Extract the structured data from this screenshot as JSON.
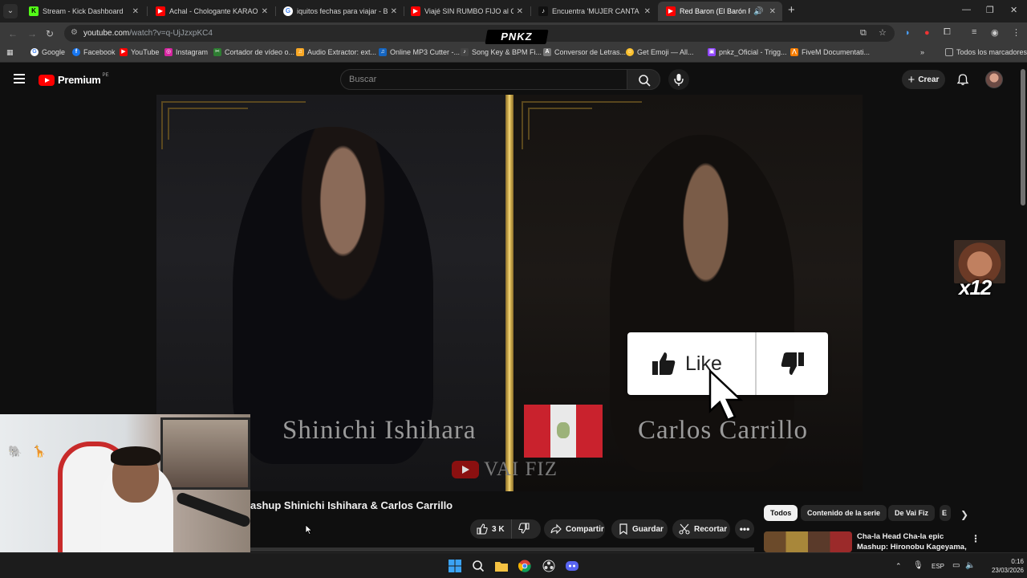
{
  "browser": {
    "tabs": [
      {
        "label": "Stream - Kick Dashboard",
        "icon": "kick-icon",
        "color": "#53fc18"
      },
      {
        "label": "Achal - Chologante KARAOKE (",
        "icon": "youtube-icon",
        "color": "#ff0000"
      },
      {
        "label": "iquitos fechas para viajar - Busc",
        "icon": "google-icon",
        "color": "#4285f4"
      },
      {
        "label": "Viajé SIN RUMBO FIJO al Coraz",
        "icon": "youtube-icon",
        "color": "#ff0000"
      },
      {
        "label": "Encuentra 'MUJER CANTA ORAC",
        "icon": "tiktok-icon",
        "color": "#ffffff"
      },
      {
        "label": "Red Baron (El Barón Rojo) c",
        "icon": "youtube-icon",
        "color": "#ff0000",
        "active": true
      }
    ],
    "url_host": "youtube.com",
    "url_path": "/watch?v=q-UjJzxpKC4",
    "overlay_logo": "PNKZ",
    "bookmarks": [
      {
        "label": "Google",
        "icon": "google-icon"
      },
      {
        "label": "Facebook",
        "icon": "facebook-icon"
      },
      {
        "label": "YouTube",
        "icon": "youtube-icon"
      },
      {
        "label": "Instagram",
        "icon": "instagram-icon"
      },
      {
        "label": "Cortador de vídeo o...",
        "icon": "scissors-icon"
      },
      {
        "label": "Audio Extractor: ext...",
        "icon": "audio-icon"
      },
      {
        "label": "Online MP3 Cutter -...",
        "icon": "audio-icon"
      },
      {
        "label": "Song Key & BPM Fi...",
        "icon": "music-icon"
      },
      {
        "label": "Conversor de Letras...",
        "icon": "text-icon"
      },
      {
        "label": "Get Emoji — All...",
        "icon": "emoji-icon"
      },
      {
        "label": "pnkz_Oficial - Trigg...",
        "icon": "twitch-icon"
      },
      {
        "label": "FiveM Documentati...",
        "icon": "fivem-icon"
      }
    ],
    "all_bookmarks": "Todos los marcadores"
  },
  "youtube": {
    "logo_word": "Premium",
    "region": "PE",
    "search_placeholder": "Buscar",
    "create_label": "Crear",
    "video": {
      "left_name": "Shinichi Ishihara",
      "right_name": "Carlos Carrillo",
      "watermark": "VAI FIZ",
      "like_overlay_label": "Like",
      "emote_multiplier": "x12",
      "progress": 0.0
    },
    "title": "ashup Shinichi Ishihara & Carlos Carrillo",
    "actions": {
      "likes": "3 K",
      "share": "Compartir",
      "save": "Guardar",
      "clip": "Recortar"
    },
    "chips": [
      "Todos",
      "Contenido de la serie",
      "De Vai Fiz",
      "E"
    ],
    "recommendation": {
      "title": "Cha-la Head Cha-la epic Mashup: Hironobu Kageyama, ..."
    }
  },
  "taskbar": {
    "language": "ESP",
    "time": "0:16",
    "date": "23/03/2026"
  },
  "colors": {
    "accent_red": "#ff0000",
    "bg": "#0f0f0f",
    "chip_active": "#f1f1f1"
  }
}
